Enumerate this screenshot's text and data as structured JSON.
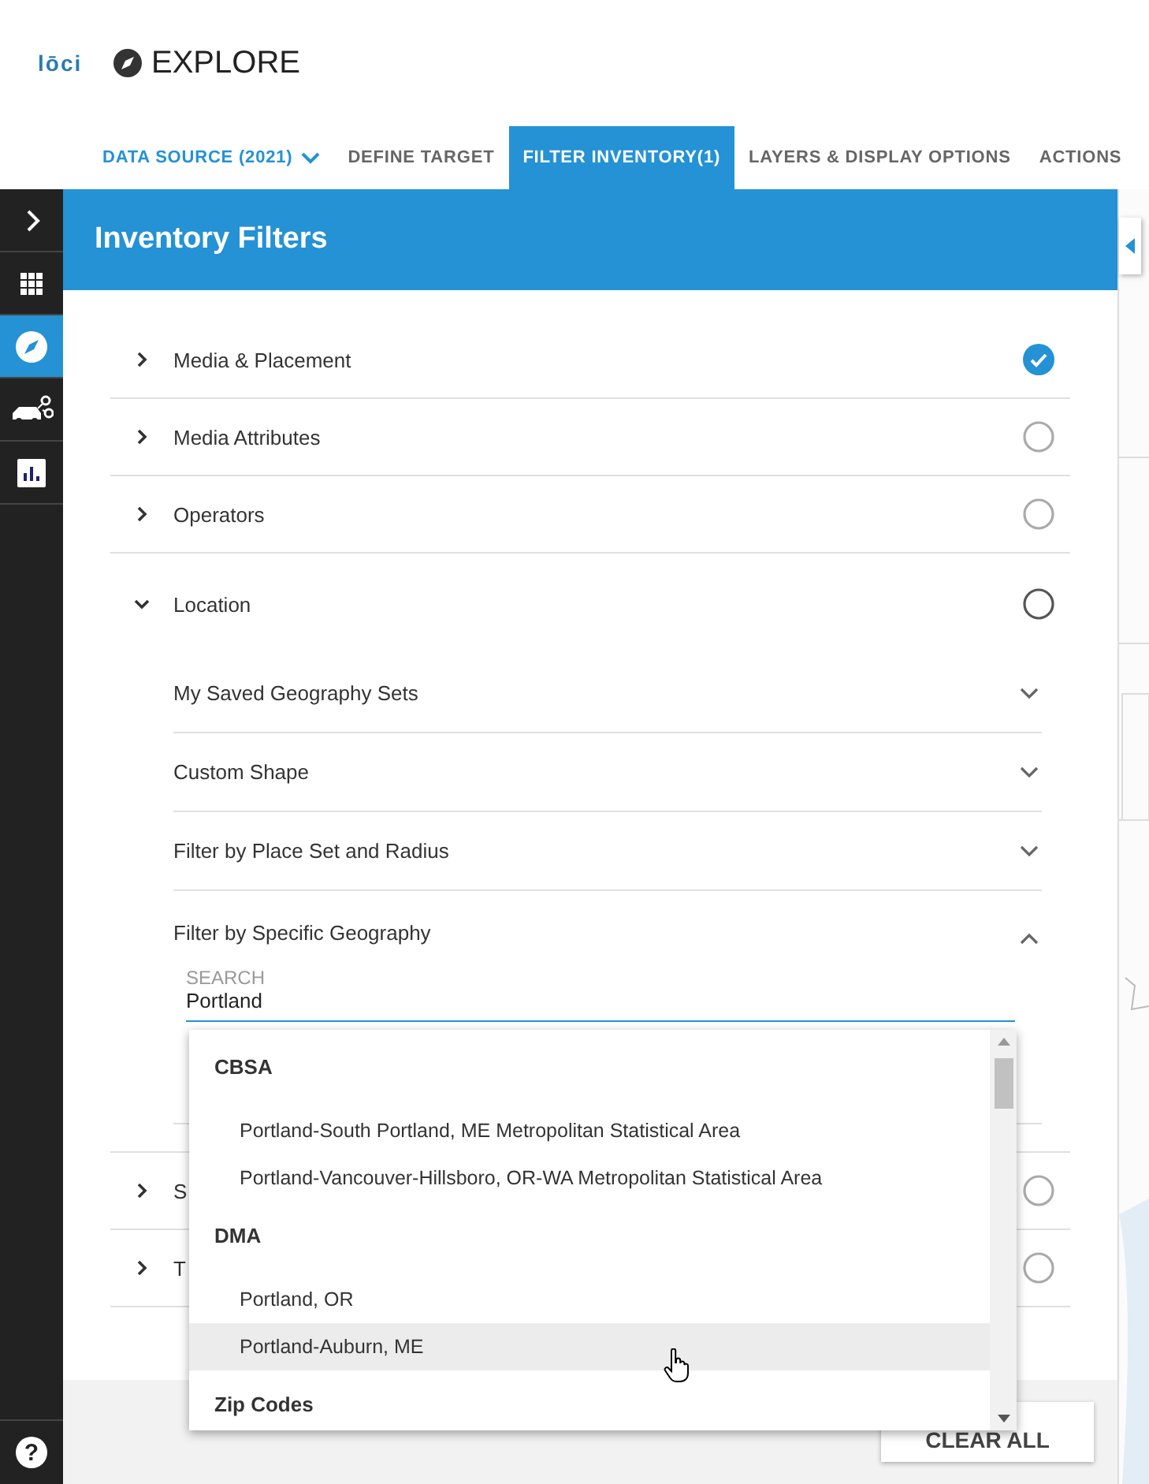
{
  "header": {
    "logo": "lōci",
    "title": "EXPLORE"
  },
  "tabs": [
    {
      "label": "DATA SOURCE (2021)",
      "kind": "dropdown",
      "selected": false
    },
    {
      "label": "DEFINE TARGET",
      "kind": "tab",
      "selected": false
    },
    {
      "label": "FILTER INVENTORY(1)",
      "kind": "tab",
      "selected": true
    },
    {
      "label": "LAYERS & DISPLAY OPTIONS",
      "kind": "tab",
      "selected": false
    },
    {
      "label": "ACTIONS",
      "kind": "tab",
      "selected": false
    }
  ],
  "sidebar": {
    "items": [
      {
        "kind": "expand",
        "selected": false
      },
      {
        "kind": "apps",
        "selected": false
      },
      {
        "kind": "explore",
        "selected": true
      },
      {
        "kind": "vehicles",
        "selected": false
      },
      {
        "kind": "chart",
        "selected": false
      }
    ],
    "help": "?"
  },
  "panel": {
    "title": "Inventory Filters",
    "filters": [
      {
        "label": "Media & Placement",
        "expanded": false,
        "checked": true
      },
      {
        "label": "Media Attributes",
        "expanded": false,
        "checked": false
      },
      {
        "label": "Operators",
        "expanded": false,
        "checked": false
      },
      {
        "label": "Location",
        "expanded": true,
        "checked": false,
        "children": [
          {
            "label": "My Saved Geography Sets",
            "expanded": false
          },
          {
            "label": "Custom Shape",
            "expanded": false
          },
          {
            "label": "Filter by Place Set and Radius",
            "expanded": false
          },
          {
            "label": "Filter by Specific Geography",
            "expanded": true,
            "search": {
              "label": "SEARCH",
              "value": "Portland"
            }
          }
        ]
      },
      {
        "label": "S",
        "expanded": false,
        "checked": false
      },
      {
        "label": "T",
        "expanded": false,
        "checked": false
      }
    ],
    "dropdown": {
      "groups": [
        {
          "title": "CBSA",
          "items": [
            {
              "label": "Portland-South Portland, ME Metropolitan Statistical Area",
              "highlighted": false
            },
            {
              "label": "Portland-Vancouver-Hillsboro, OR-WA Metropolitan Statistical Area",
              "highlighted": false
            }
          ]
        },
        {
          "title": "DMA",
          "items": [
            {
              "label": "Portland, OR",
              "highlighted": false
            },
            {
              "label": "Portland-Auburn, ME",
              "highlighted": true
            }
          ]
        },
        {
          "title": "Zip Codes"
        }
      ]
    },
    "footer": {
      "button": "CLEAR ALL"
    }
  }
}
